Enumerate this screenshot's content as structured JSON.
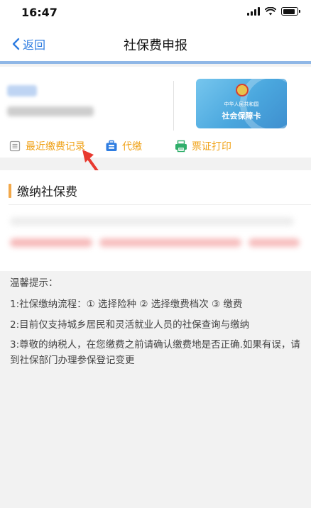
{
  "status_bar": {
    "time": "16:47"
  },
  "nav": {
    "back_label": "返回",
    "title": "社保费申报"
  },
  "card": {
    "card_line1": "中华人民共和国",
    "card_line2": "社会保障卡"
  },
  "actions": [
    {
      "label": "最近缴费记录",
      "icon": "document-icon"
    },
    {
      "label": "代缴",
      "icon": "briefcase-icon"
    },
    {
      "label": "票证打印",
      "icon": "printer-icon"
    }
  ],
  "section": {
    "title": "缴纳社保费"
  },
  "tips": {
    "heading": "温馨提示：",
    "line1": "1:社保缴纳流程：① 选择险种 ② 选择缴费档次 ③ 缴费",
    "line2": "2:目前仅支持城乡居民和灵活就业人员的社保查询与缴纳",
    "line3": "3:尊敬的纳税人，在您缴费之前请确认缴费地是否正确.如果有误，请到社保部门办理参保登记变更"
  },
  "colors": {
    "accent_blue": "#2f7de1",
    "action_orange": "#f0a31a",
    "section_bar": "#f2a84a",
    "nav_border": "#8fb7e6"
  }
}
